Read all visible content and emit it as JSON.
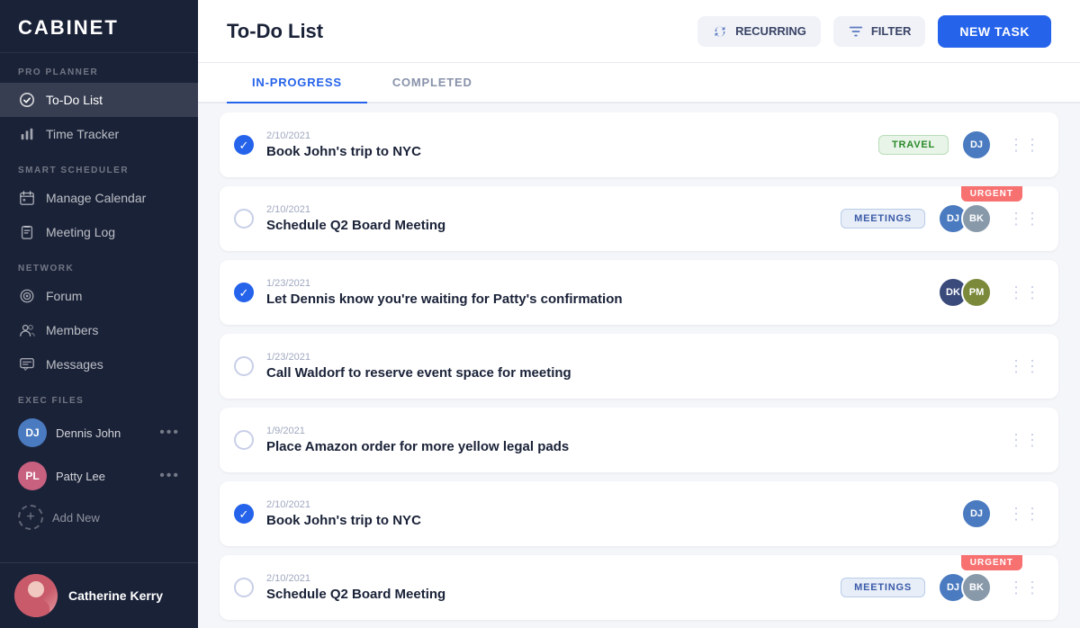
{
  "sidebar": {
    "logo": "CABINET",
    "sections": {
      "pro_planner": {
        "label": "PRO PLANNER",
        "items": [
          {
            "id": "todo",
            "label": "To-Do List",
            "active": true,
            "icon": "check-circle-icon"
          },
          {
            "id": "time",
            "label": "Time Tracker",
            "active": false,
            "icon": "chart-icon"
          }
        ]
      },
      "smart_scheduler": {
        "label": "SMART SCHEDULER",
        "items": [
          {
            "id": "calendar",
            "label": "Manage Calendar",
            "active": false,
            "icon": "calendar-icon"
          },
          {
            "id": "meeting",
            "label": "Meeting Log",
            "active": false,
            "icon": "clipboard-icon"
          }
        ]
      },
      "network": {
        "label": "NETWORK",
        "items": [
          {
            "id": "forum",
            "label": "Forum",
            "active": false,
            "icon": "forum-icon"
          },
          {
            "id": "members",
            "label": "Members",
            "active": false,
            "icon": "members-icon"
          },
          {
            "id": "messages",
            "label": "Messages",
            "active": false,
            "icon": "messages-icon"
          }
        ]
      },
      "exec_files": {
        "label": "EXEC FILES",
        "executives": [
          {
            "id": "dennis",
            "name": "Dennis John",
            "initials": "DJ",
            "color": "#4a7abf"
          },
          {
            "id": "patty",
            "name": "Patty Lee",
            "initials": "PL",
            "color": "#c86080"
          }
        ],
        "add_new_label": "Add New"
      }
    },
    "footer": {
      "name": "Catherine Kerry"
    }
  },
  "header": {
    "title": "To-Do List",
    "recurring_label": "RECURRING",
    "filter_label": "FILTER",
    "new_task_label": "NEW TASK"
  },
  "tabs": [
    {
      "id": "in-progress",
      "label": "IN-PROGRESS",
      "active": true
    },
    {
      "id": "completed",
      "label": "COMPLETED",
      "active": false
    }
  ],
  "tasks": [
    {
      "id": 1,
      "date": "2/10/2021",
      "title": "Book John's trip to NYC",
      "checked": true,
      "badge": "TRAVEL",
      "badge_type": "travel",
      "urgent": false,
      "avatars": [
        {
          "color": "#4a7abf",
          "initials": "DJ"
        }
      ]
    },
    {
      "id": 2,
      "date": "2/10/2021",
      "title": "Schedule Q2 Board Meeting",
      "checked": false,
      "badge": "MEETINGS",
      "badge_type": "meetings",
      "urgent": true,
      "avatars": [
        {
          "color": "#4a7abf",
          "initials": "DJ"
        },
        {
          "color": "#8899aa",
          "initials": "BK"
        }
      ]
    },
    {
      "id": 3,
      "date": "1/23/2021",
      "title": "Let Dennis know you're waiting for Patty's confirmation",
      "checked": true,
      "badge": null,
      "badge_type": null,
      "urgent": false,
      "avatars": [
        {
          "color": "#3a4a7a",
          "initials": "DK"
        },
        {
          "color": "#7a8a3a",
          "initials": "PM"
        }
      ]
    },
    {
      "id": 4,
      "date": "1/23/2021",
      "title": "Call Waldorf to reserve event space for meeting",
      "checked": false,
      "badge": null,
      "badge_type": null,
      "urgent": false,
      "avatars": []
    },
    {
      "id": 5,
      "date": "1/9/2021",
      "title": "Place Amazon order for more yellow legal pads",
      "checked": false,
      "badge": null,
      "badge_type": null,
      "urgent": false,
      "avatars": []
    },
    {
      "id": 6,
      "date": "2/10/2021",
      "title": "Book John's trip to NYC",
      "checked": true,
      "badge": null,
      "badge_type": null,
      "urgent": false,
      "avatars": [
        {
          "color": "#4a7abf",
          "initials": "DJ"
        }
      ]
    },
    {
      "id": 7,
      "date": "2/10/2021",
      "title": "Schedule Q2 Board Meeting",
      "checked": false,
      "badge": "MEETINGS",
      "badge_type": "meetings",
      "urgent": true,
      "avatars": [
        {
          "color": "#4a7abf",
          "initials": "DJ"
        },
        {
          "color": "#8899aa",
          "initials": "BK"
        }
      ]
    }
  ]
}
